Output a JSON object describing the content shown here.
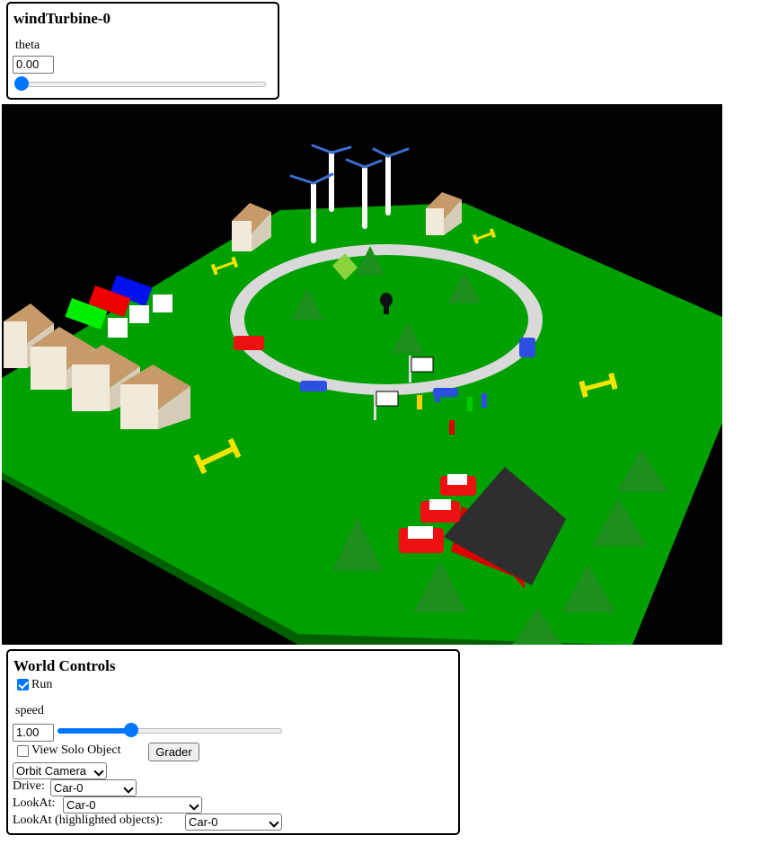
{
  "turbine_panel": {
    "title": "windTurbine-0",
    "param_label": "theta",
    "param_value": "0.00",
    "param_slider_fraction": 0.0
  },
  "scene": {
    "description_name": "3d-world-viewport",
    "colors": {
      "background": "#000000",
      "ground": "#00a000",
      "track": "#d9d9d9",
      "helipad": "#f4e400"
    }
  },
  "world_controls": {
    "title": "World Controls",
    "run_label": "Run",
    "run_checked": true,
    "speed_label": "speed",
    "speed_value": "1.00",
    "speed_slider_fraction": 0.33,
    "solo_label": "View Solo Object",
    "solo_checked": false,
    "grader_label": "Grader",
    "camera_select": "Orbit Camera",
    "drive_label": "Drive:",
    "drive_select": "Car-0",
    "lookat_label": "LookAt:",
    "lookat_select": "Car-0",
    "lookat_highlighted_label": "LookAt (highlighted objects):",
    "lookat_highlighted_select": "Car-0"
  }
}
